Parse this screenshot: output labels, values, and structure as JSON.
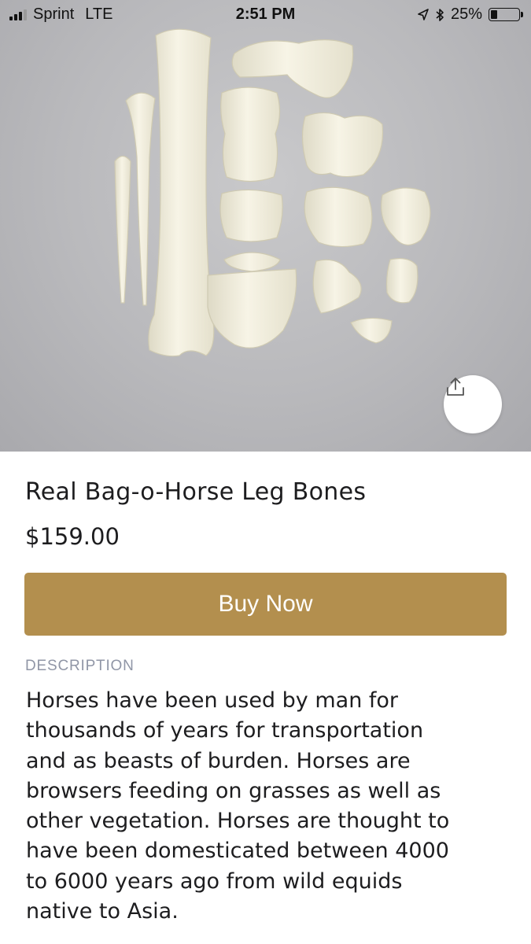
{
  "status_bar": {
    "carrier": "Sprint",
    "network": "LTE",
    "time": "2:51 PM",
    "battery_percent": "25%",
    "battery_level": 0.25,
    "signal_bars_filled": 3,
    "icons": [
      "signal-icon",
      "location-arrow-icon",
      "bluetooth-icon",
      "battery-icon"
    ]
  },
  "hero": {
    "image_alt": "Horse leg bones arranged on a grey background",
    "share_icon": "share-icon"
  },
  "product": {
    "title": "Real Bag-o-Horse Leg Bones",
    "price": "$159.00"
  },
  "buy_button": {
    "label": "Buy Now",
    "color": "#b38f4e"
  },
  "description": {
    "heading": "DESCRIPTION",
    "lines": [
      "Horses have been used by man for",
      "thousands of years for transportation",
      "and as beasts of burden. Horses are",
      "browsers feeding on grasses as well as",
      "other vegetation. Horses are thought to",
      "have been domesticated between 4000",
      "to 6000 years ago from wild equids",
      "native to Asia."
    ]
  }
}
